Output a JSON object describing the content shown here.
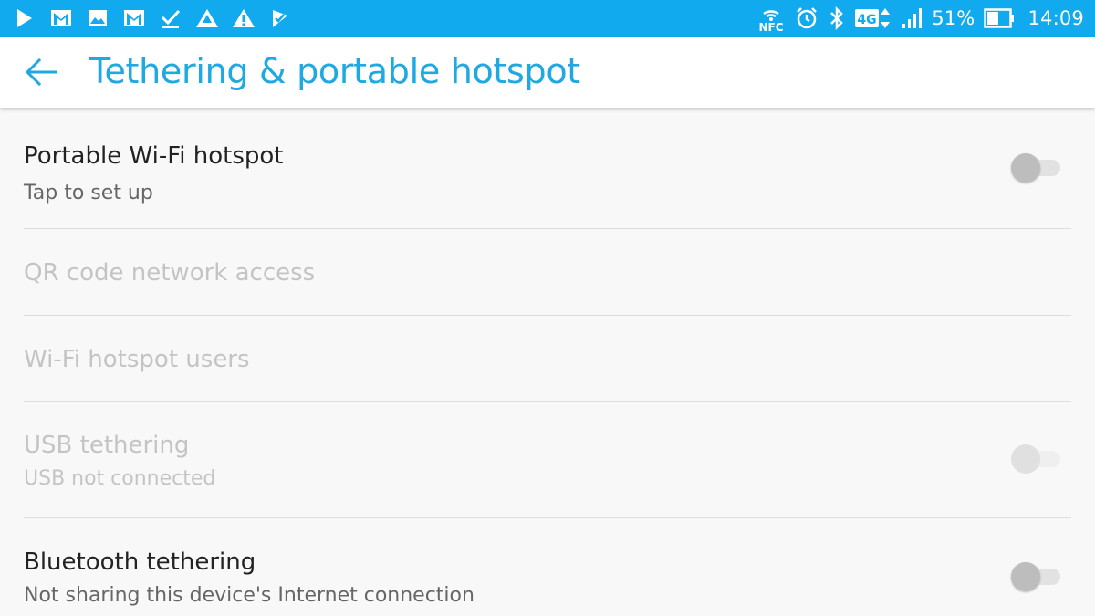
{
  "status_bar": {
    "nfc_label": "NFC",
    "network_label": "4G",
    "battery_text": "51%",
    "time": "14:09",
    "battery_level": 0.51,
    "left_icons": [
      "play-store-icon",
      "gmail-icon",
      "image-icon",
      "gmail-icon",
      "check-icon",
      "drive-warning-icon",
      "warning-icon",
      "check-arrow-icon"
    ],
    "right_icons": [
      "nfc-icon",
      "alarm-icon",
      "bluetooth-icon",
      "network-4g-icon",
      "signal-icon",
      "battery-icon"
    ]
  },
  "app_bar": {
    "title": "Tethering & portable hotspot",
    "back_icon": "arrow-back-icon"
  },
  "colors": {
    "status_bar": "#11aaee",
    "accent": "#1fa9e3",
    "background": "#f8f8f8"
  },
  "settings": [
    {
      "title": "Portable Wi-Fi hotspot",
      "subtitle": "Tap to set up",
      "has_switch": true,
      "switch_on": false,
      "enabled": true
    },
    {
      "title": "QR code network access",
      "subtitle": "",
      "has_switch": false,
      "enabled": false
    },
    {
      "title": "Wi-Fi hotspot users",
      "subtitle": "",
      "has_switch": false,
      "enabled": false
    },
    {
      "title": "USB tethering",
      "subtitle": "USB not connected",
      "has_switch": true,
      "switch_on": false,
      "enabled": false
    },
    {
      "title": "Bluetooth tethering",
      "subtitle": "Not sharing this device's Internet connection",
      "has_switch": true,
      "switch_on": false,
      "enabled": true
    }
  ]
}
